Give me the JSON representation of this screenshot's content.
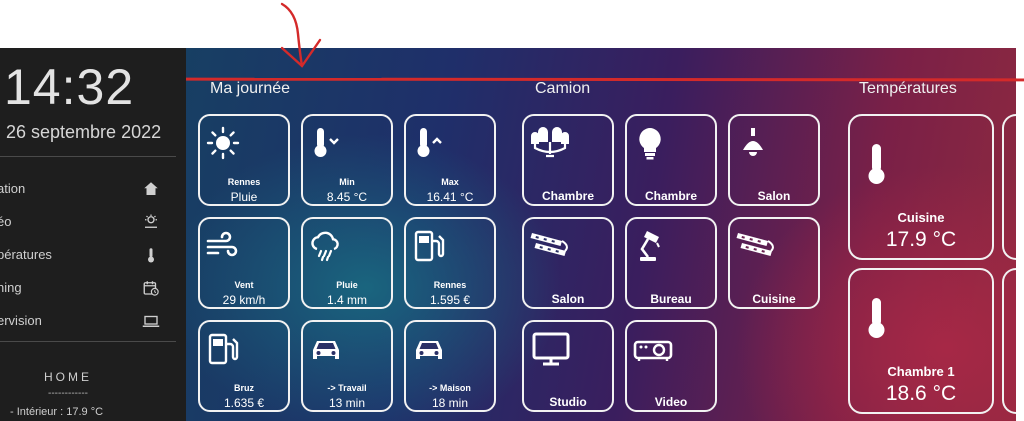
{
  "sidebar": {
    "time": "14:32",
    "date": "i 26 septembre 2022",
    "nav": [
      {
        "label": "ation",
        "icon": "home-icon"
      },
      {
        "label": "éo",
        "icon": "weather-icon"
      },
      {
        "label": "pératures",
        "icon": "thermometer-icon"
      },
      {
        "label": "ning",
        "icon": "calendar-clock-icon"
      },
      {
        "label": "ervision",
        "icon": "laptop-icon"
      }
    ],
    "home_title": "HOME",
    "home_dashes": "------------",
    "home_interior": "- Intérieur : 17.9 °C"
  },
  "sections": {
    "day": "Ma journée",
    "truck": "Camion",
    "temps": "Températures"
  },
  "day_tiles": [
    {
      "icon": "sun-icon",
      "title": "Rennes",
      "value": "Pluie"
    },
    {
      "icon": "thermometer-down-icon",
      "title": "Min",
      "value": "8.45 °C"
    },
    {
      "icon": "thermometer-up-icon",
      "title": "Max",
      "value": "16.41 °C"
    },
    {
      "icon": "wind-icon",
      "title": "Vent",
      "value": "29 km/h"
    },
    {
      "icon": "rain-cloud-icon",
      "title": "Pluie",
      "value": "1.4 mm"
    },
    {
      "icon": "fuel-pump-icon",
      "title": "Rennes",
      "value": "1.595 €"
    },
    {
      "icon": "fuel-pump-icon",
      "title": "Bruz",
      "value": "1.635 €"
    },
    {
      "icon": "car-icon",
      "title": "-> Travail",
      "value": "13 min"
    },
    {
      "icon": "car-icon",
      "title": "-> Maison",
      "value": "18 min"
    }
  ],
  "truck_tiles": [
    {
      "icon": "chandelier-icon",
      "label": "Chambre"
    },
    {
      "icon": "bulb-icon",
      "label": "Chambre"
    },
    {
      "icon": "ceiling-lamp-icon",
      "label": "Salon"
    },
    {
      "icon": "led-strip-icon",
      "label": "Salon"
    },
    {
      "icon": "desk-lamp-icon",
      "label": "Bureau"
    },
    {
      "icon": "led-strip-icon",
      "label": "Cuisine"
    },
    {
      "icon": "monitor-icon",
      "label": "Studio"
    },
    {
      "icon": "projector-icon",
      "label": "Video"
    }
  ],
  "temp_tiles": [
    {
      "icon": "thermometer-icon",
      "room": "Cuisine",
      "value": "17.9 °C"
    },
    {
      "icon": "thermometer-icon",
      "room": "Chambre 1",
      "value": "18.6 °C"
    }
  ],
  "colors": {
    "annotation_red": "#d42a2a",
    "sidebar_bg": "#1e1e1e",
    "tile_border": "#f2f2f2"
  }
}
